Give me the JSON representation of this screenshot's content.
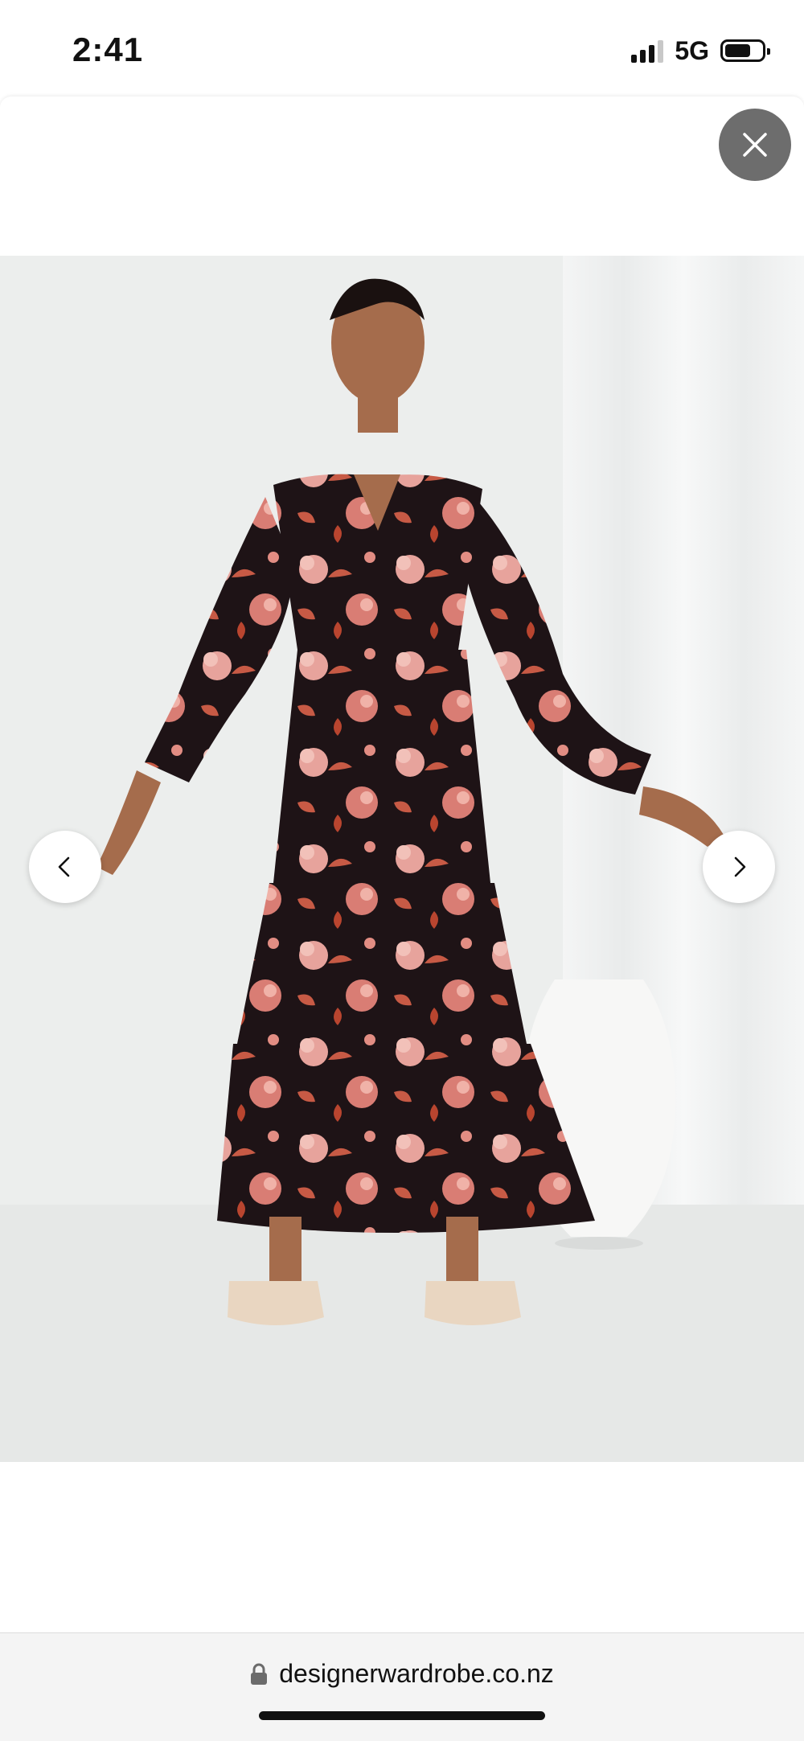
{
  "status_bar": {
    "time": "2:41",
    "network": "5G",
    "signal_bars_filled": 3,
    "signal_bars_total": 4,
    "battery_level": 0.7
  },
  "viewer": {
    "close_icon": "close-icon",
    "prev_icon": "chevron-left-icon",
    "next_icon": "chevron-right-icon",
    "image_alt": "Model in black floral tiered maxi dress with blouson sleeves and espadrille wedges",
    "colors": {
      "backdrop": "#eceeed",
      "dress": "#1e1316",
      "flower_pink": "#e7a39c",
      "flower_rust": "#c75a45",
      "close_button": "#6d6d6d"
    }
  },
  "browser": {
    "url": "designerwardrobe.co.nz",
    "lock_icon": "lock-icon"
  }
}
